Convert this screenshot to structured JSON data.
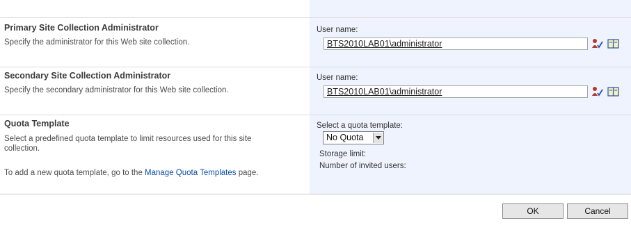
{
  "primary": {
    "title": "Primary Site Collection Administrator",
    "description": "Specify the administrator for this Web site collection.",
    "field_label": "User name:",
    "value": "BTS2010LAB01\\administrator"
  },
  "secondary": {
    "title": "Secondary Site Collection Administrator",
    "description": "Specify the secondary administrator for this Web site collection.",
    "field_label": "User name:",
    "value": "BTS2010LAB01\\administrator"
  },
  "quota": {
    "title": "Quota Template",
    "description": "Select a predefined quota template to limit resources used for this site collection.",
    "add_prefix": "To add a new quota template, go to the ",
    "add_link": "Manage Quota Templates",
    "add_suffix": " page.",
    "select_label": "Select a quota template:",
    "selected": "No Quota",
    "storage_limit_label": "Storage limit:",
    "invited_users_label": "Number of invited users:"
  },
  "buttons": {
    "ok": "OK",
    "cancel": "Cancel"
  },
  "icons": {
    "check_names": "check-names-icon",
    "browse": "address-book-icon"
  }
}
